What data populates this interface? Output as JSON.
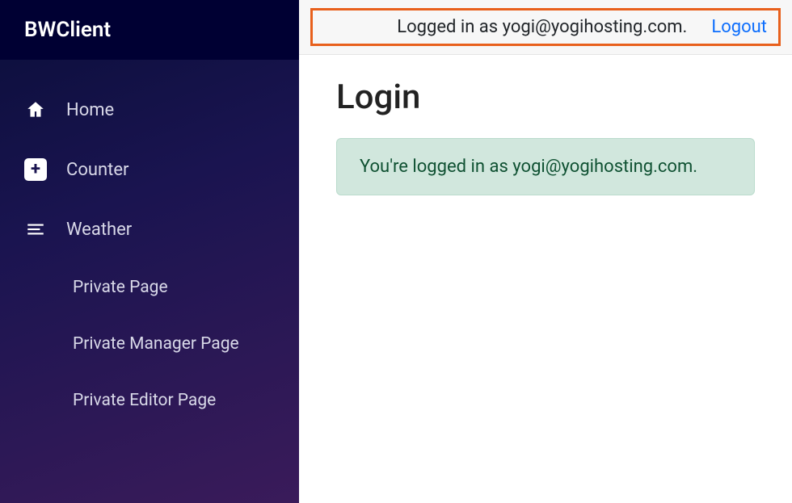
{
  "brand": "BWClient",
  "sidebar": {
    "items": [
      {
        "label": "Home",
        "icon": "home-icon"
      },
      {
        "label": "Counter",
        "icon": "plus-icon"
      },
      {
        "label": "Weather",
        "icon": "list-icon"
      }
    ],
    "subitems": [
      {
        "label": "Private Page"
      },
      {
        "label": "Private Manager Page"
      },
      {
        "label": "Private Editor Page"
      }
    ]
  },
  "topbar": {
    "logged_in_text": "Logged in as yogi@yogihosting.com.",
    "logout_label": "Logout"
  },
  "page": {
    "title": "Login",
    "alert_text": "You're logged in as yogi@yogihosting.com."
  }
}
